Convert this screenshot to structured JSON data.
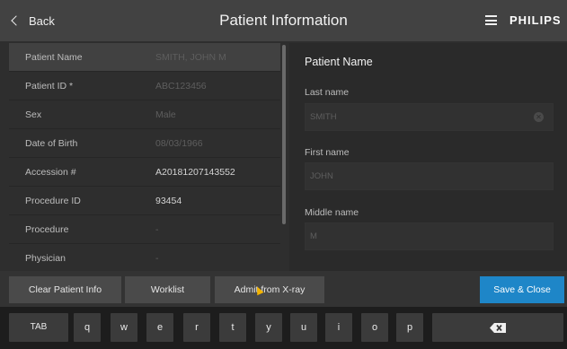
{
  "header": {
    "back_label": "Back",
    "title": "Patient Information",
    "menu_icon": "hamburger-menu-icon",
    "brand": "PHILIPS"
  },
  "patient_list": {
    "rows": [
      {
        "label": "Patient Name",
        "value": "SMITH, JOHN M",
        "filled": false,
        "selected": true
      },
      {
        "label": "Patient ID *",
        "value": "ABC123456",
        "filled": false,
        "selected": false
      },
      {
        "label": "Sex",
        "value": "Male",
        "filled": false,
        "selected": false
      },
      {
        "label": "Date of Birth",
        "value": "08/03/1966",
        "filled": false,
        "selected": false
      },
      {
        "label": "Accession #",
        "value": "A20181207143552",
        "filled": true,
        "selected": false
      },
      {
        "label": "Procedure ID",
        "value": "93454",
        "filled": true,
        "selected": false
      },
      {
        "label": "Procedure",
        "value": "-",
        "filled": false,
        "selected": false
      },
      {
        "label": "Physician",
        "value": "-",
        "filled": false,
        "selected": false
      }
    ]
  },
  "detail_panel": {
    "section_title": "Patient Name",
    "fields": {
      "last_name": {
        "label": "Last name",
        "value": "SMITH"
      },
      "first_name": {
        "label": "First name",
        "value": "JOHN"
      },
      "middle_name": {
        "label": "Middle name",
        "value": "M"
      }
    }
  },
  "action_bar": {
    "clear_label": "Clear Patient Info",
    "worklist_label": "Worklist",
    "admit_label": "Admit from X-ray",
    "save_label": "Save & Close",
    "primary_color": "#1e86c8"
  },
  "keyboard": {
    "tab_label": "TAB",
    "letters": [
      "q",
      "w",
      "e",
      "r",
      "t",
      "y",
      "u",
      "i",
      "o",
      "p"
    ],
    "backspace_icon": "backspace-icon"
  }
}
